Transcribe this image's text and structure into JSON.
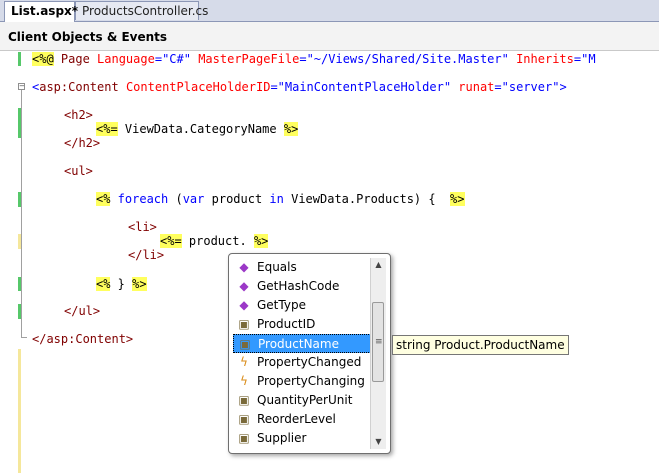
{
  "tabs": [
    {
      "label": "List.aspx*",
      "active": true
    },
    {
      "label": "ProductsController.cs",
      "active": false
    }
  ],
  "dropdown_bar": {
    "label": "Client Objects & Events"
  },
  "code": {
    "line1": {
      "open": "<%@",
      "directive": " Page",
      "a1": " Language",
      "v1": "=\"C#\"",
      "a2": " MasterPageFile",
      "v2": "=\"~/Views/Shared/Site.Master\"",
      "a3": " Inherits",
      "v3": "=\"M"
    },
    "line2": {
      "lt": "<",
      "tag": "asp:Content",
      "a1": " ContentPlaceHolderID",
      "v1": "=\"MainContentPlaceHolder\"",
      "a2": " runat",
      "v2": "=\"server\"",
      "gt": ">"
    },
    "line3": {
      "text": "<h2>"
    },
    "line4": {
      "open": "<%=",
      "body": " ViewData.CategoryName ",
      "close": "%>"
    },
    "line5": {
      "text": "</h2>"
    },
    "line6": {
      "text": "<ul>"
    },
    "line7": {
      "open": "<%",
      "kw1": " foreach",
      "p1": " (",
      "kw2": "var",
      "p2": " product ",
      "kw3": "in",
      "p3": " ViewData.Products) {  ",
      "close": "%>"
    },
    "line8": {
      "text": "<li>"
    },
    "line9": {
      "open": "<%=",
      "body": " product. ",
      "close": "%>"
    },
    "line10": {
      "text": "</li>"
    },
    "line11": {
      "open": "<%",
      "body": " } ",
      "close": "%>"
    },
    "line12": {
      "text": "</ul>"
    },
    "line13": {
      "text": "</asp:Content>"
    }
  },
  "intellisense": {
    "items": [
      {
        "label": "Equals",
        "icon": "method-icon"
      },
      {
        "label": "GetHashCode",
        "icon": "method-icon"
      },
      {
        "label": "GetType",
        "icon": "method-icon"
      },
      {
        "label": "ProductID",
        "icon": "property-icon"
      },
      {
        "label": "ProductName",
        "icon": "property-icon",
        "selected": true
      },
      {
        "label": "PropertyChanged",
        "icon": "event-icon"
      },
      {
        "label": "PropertyChanging",
        "icon": "event-icon"
      },
      {
        "label": "QuantityPerUnit",
        "icon": "property-icon"
      },
      {
        "label": "ReorderLevel",
        "icon": "property-icon"
      },
      {
        "label": "Supplier",
        "icon": "property-icon"
      }
    ],
    "tooltip": "string Product.ProductName"
  },
  "colors": {
    "highlight_yellow": "#ffff5e",
    "tag_maroon": "#800000",
    "attribute_red": "#ff0000",
    "keyword_blue": "#0000ff",
    "selection_blue": "#3399ff",
    "tooltip_bg": "#ffffe1"
  }
}
